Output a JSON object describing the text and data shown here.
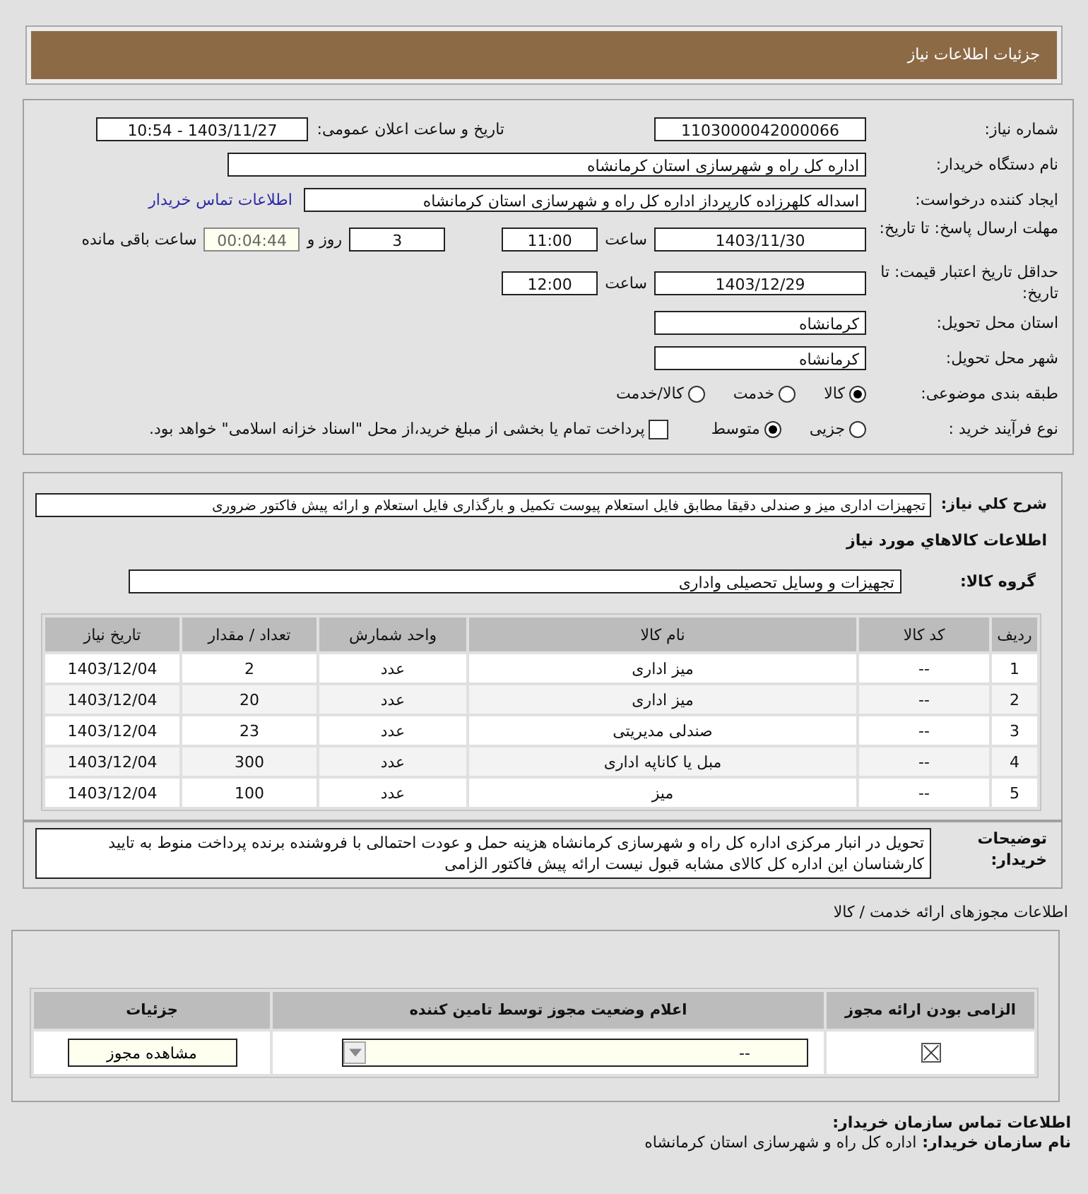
{
  "header": {
    "title": "جزئیات اطلاعات نیاز"
  },
  "need_number": {
    "label": "شماره نیاز:",
    "value": "1103000042000066"
  },
  "announce": {
    "label": "تاریخ و ساعت اعلان عمومی:",
    "value": "1403/11/27 - 10:54"
  },
  "buyer_org": {
    "label": "نام دستگاه خریدار:",
    "value": "اداره کل راه و شهرسازی استان کرمانشاه"
  },
  "requester": {
    "label": "ایجاد کننده درخواست:",
    "value": "اسداله کلهرزاده کارپرداز اداره کل راه و شهرسازی استان کرمانشاه",
    "link": "اطلاعات تماس خریدار"
  },
  "deadline": {
    "label": "مهلت ارسال پاسخ: تا تاریخ:",
    "date": "1403/11/30",
    "time_label": "ساعت",
    "time": "11:00",
    "days": "3",
    "days_label": "روز و",
    "remaining": "00:04:44",
    "remaining_label": "ساعت باقی مانده"
  },
  "validity": {
    "label": "حداقل تاریخ اعتبار قیمت: تا تاریخ:",
    "date": "1403/12/29",
    "time_label": "ساعت",
    "time": "12:00"
  },
  "province": {
    "label": "استان محل تحویل:",
    "value": "کرمانشاه"
  },
  "city": {
    "label": "شهر محل تحویل:",
    "value": "کرمانشاه"
  },
  "category": {
    "label": "طبقه بندی موضوعی:",
    "options": [
      {
        "label": "کالا",
        "selected": true
      },
      {
        "label": "خدمت",
        "selected": false
      },
      {
        "label": "کالا/خدمت",
        "selected": false
      }
    ]
  },
  "process": {
    "label": "نوع فرآیند خرید :",
    "options": [
      {
        "label": "جزیی",
        "selected": false
      },
      {
        "label": "متوسط",
        "selected": true
      }
    ],
    "payment": {
      "checked": false,
      "text": "پرداخت تمام یا بخشی از مبلغ خرید،از محل \"اسناد خزانه اسلامی\" خواهد بود."
    }
  },
  "description": {
    "label": "شرح کلي نياز:",
    "value": "تجهیزات اداری میز و صندلی دقیقا مطابق فایل استعلام پیوست تکمیل و بارگذاری فایل استعلام و ارائه پیش فاکتور ضروری"
  },
  "goods_heading": "اطلاعات کالاهاي مورد نياز",
  "goods_group": {
    "label": "گروه کالا:",
    "value": "تجهیزات و وسایل تحصیلی واداری"
  },
  "table": {
    "columns": [
      "ردیف",
      "کد کالا",
      "نام کالا",
      "واحد شمارش",
      "تعداد / مقدار",
      "تاریخ نیاز"
    ],
    "rows": [
      [
        "1",
        "--",
        "میز اداری",
        "عدد",
        "2",
        "1403/12/04"
      ],
      [
        "2",
        "--",
        "میز اداری",
        "عدد",
        "20",
        "1403/12/04"
      ],
      [
        "3",
        "--",
        "صندلی مدیریتی",
        "عدد",
        "23",
        "1403/12/04"
      ],
      [
        "4",
        "--",
        "مبل یا کاناپه اداری",
        "عدد",
        "300",
        "1403/12/04"
      ],
      [
        "5",
        "--",
        "میز",
        "عدد",
        "100",
        "1403/12/04"
      ]
    ]
  },
  "buyer_notes": {
    "label": "توضیحات خریدار:",
    "value": "تحویل در انبار مرکزی اداره کل راه و شهرسازی کرمانشاه هزینه حمل و عودت احتمالی با فروشنده برنده پرداخت منوط به تایید کارشناسان این اداره کل کالای مشابه قبول نیست ارائه پیش فاکتور الزامی"
  },
  "permits_heading": "اطلاعات مجوزهای ارائه خدمت / کالا",
  "permits": {
    "columns": [
      "الزامی بودن ارائه مجوز",
      "اعلام وضعیت مجوز توسط تامین کننده",
      "جزئیات"
    ],
    "rows": [
      {
        "required": true,
        "status": "--",
        "button": "مشاهده مجوز"
      }
    ]
  },
  "contact": {
    "title": "اطلاعات تماس سازمان خریدار:",
    "org_label": "نام سازمان خریدار:",
    "org_value": "اداره کل راه و شهرسازی استان کرمانشاه"
  }
}
